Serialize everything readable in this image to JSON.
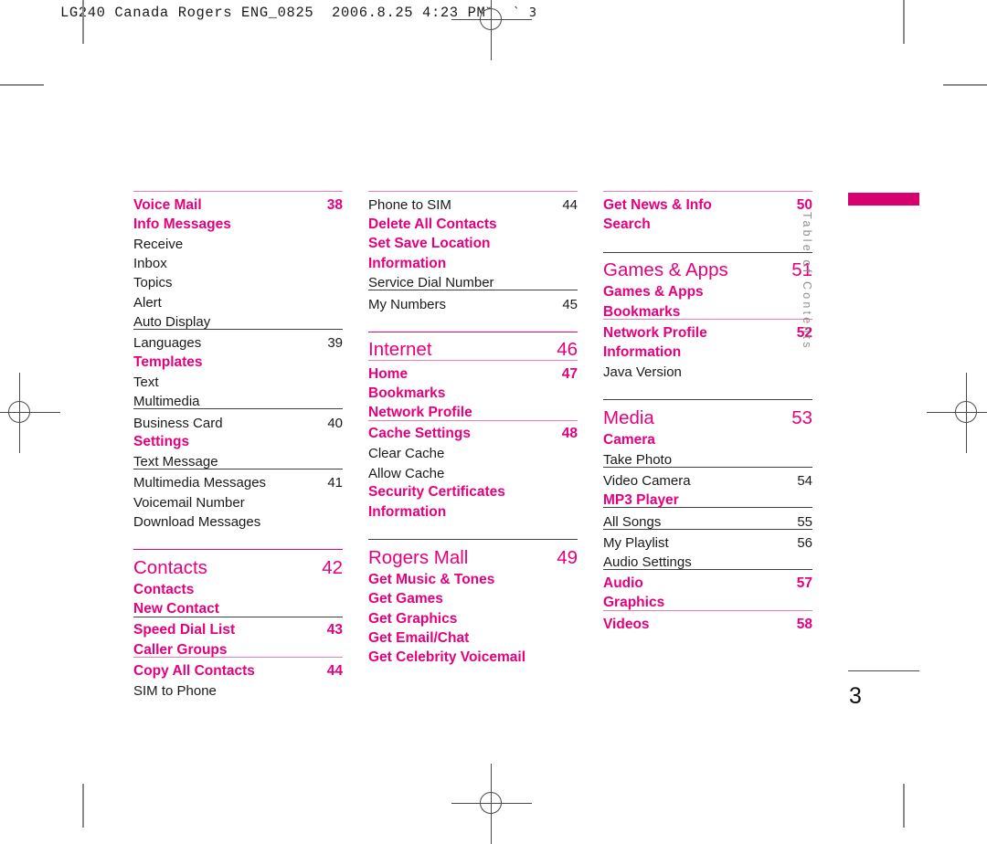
{
  "print_header": {
    "text": "LG240 Canada Rogers ENG_0825  2006.8.25 4:23 PM",
    "marks": "˘     ˋ  3"
  },
  "tab": {
    "label": "Table of Contents",
    "bar_color": "#D6006E"
  },
  "folio": {
    "page_number": "3"
  },
  "colors": {
    "accent_pink": "#E4007E",
    "light_pink_rule": "#EE7BB4",
    "dark_rule": "#404040",
    "body_text": "#1a1a1a",
    "tab_label": "#8e8e8e"
  },
  "columns": [
    {
      "id": "col-1",
      "entries": [
        {
          "title": "Voice Mail",
          "page": "38",
          "level": "sub",
          "rule": "pinklt"
        },
        {
          "title": "Info Messages",
          "page": "",
          "level": "sub",
          "rule": "none"
        },
        {
          "title": "Receive",
          "page": "",
          "level": "item",
          "rule": "none"
        },
        {
          "title": "Inbox",
          "page": "",
          "level": "item",
          "rule": "none"
        },
        {
          "title": "Topics",
          "page": "",
          "level": "item",
          "rule": "none"
        },
        {
          "title": "Alert",
          "page": "",
          "level": "item",
          "rule": "none"
        },
        {
          "title": "Auto Display",
          "page": "",
          "level": "item",
          "rule": "none"
        },
        {
          "title": "Languages",
          "page": "39",
          "level": "item",
          "rule": "dark"
        },
        {
          "title": "Templates",
          "page": "",
          "level": "sub",
          "rule": "none"
        },
        {
          "title": "Text",
          "page": "",
          "level": "item",
          "rule": "none"
        },
        {
          "title": "Multimedia",
          "page": "",
          "level": "item",
          "rule": "none"
        },
        {
          "title": "Business Card",
          "page": "40",
          "level": "item",
          "rule": "dark"
        },
        {
          "title": "Settings",
          "page": "",
          "level": "sub",
          "rule": "none"
        },
        {
          "title": "Text Message",
          "page": "",
          "level": "item",
          "rule": "none"
        },
        {
          "title": "Multimedia Messages",
          "page": "41",
          "level": "item",
          "rule": "dark"
        },
        {
          "title": "Voicemail Number",
          "page": "",
          "level": "item",
          "rule": "none"
        },
        {
          "title": "Download Messages",
          "page": "",
          "level": "item",
          "rule": "none"
        },
        {
          "title": "",
          "page": "",
          "level": "gap",
          "rule": "none"
        },
        {
          "title": "Contacts",
          "page": "42",
          "level": "section",
          "rule": "pink"
        },
        {
          "title": "Contacts",
          "page": "",
          "level": "sub",
          "rule": "none"
        },
        {
          "title": "New Contact",
          "page": "",
          "level": "sub",
          "rule": "none"
        },
        {
          "title": "Speed Dial List",
          "page": "43",
          "level": "sub",
          "rule": "dark"
        },
        {
          "title": "Caller Groups",
          "page": "",
          "level": "sub",
          "rule": "none"
        },
        {
          "title": "Copy All Contacts",
          "page": "44",
          "level": "sub",
          "rule": "pinklt"
        },
        {
          "title": "SIM to Phone",
          "page": "",
          "level": "item",
          "rule": "none"
        }
      ]
    },
    {
      "id": "col-2",
      "entries": [
        {
          "title": "Phone to SIM",
          "page": "44",
          "level": "item",
          "rule": "pinklt"
        },
        {
          "title": "Delete All Contacts",
          "page": "",
          "level": "sub",
          "rule": "none"
        },
        {
          "title": "Set Save Location",
          "page": "",
          "level": "sub",
          "rule": "none"
        },
        {
          "title": "Information",
          "page": "",
          "level": "sub",
          "rule": "none"
        },
        {
          "title": "Service Dial Number",
          "page": "",
          "level": "item",
          "rule": "none"
        },
        {
          "title": "My Numbers",
          "page": "45",
          "level": "item",
          "rule": "dark"
        },
        {
          "title": "",
          "page": "",
          "level": "gap",
          "rule": "none"
        },
        {
          "title": "Internet",
          "page": "46",
          "level": "section",
          "rule": "pink"
        },
        {
          "title": "Home",
          "page": "47",
          "level": "sub",
          "rule": "pinklt"
        },
        {
          "title": "Bookmarks",
          "page": "",
          "level": "sub",
          "rule": "none"
        },
        {
          "title": "Network Profile",
          "page": "",
          "level": "sub",
          "rule": "none"
        },
        {
          "title": "Cache Settings",
          "page": "48",
          "level": "sub",
          "rule": "pinklt"
        },
        {
          "title": "Clear Cache",
          "page": "",
          "level": "item",
          "rule": "none"
        },
        {
          "title": "Allow Cache",
          "page": "",
          "level": "item",
          "rule": "none"
        },
        {
          "title": "Security Certificates",
          "page": "",
          "level": "sub",
          "rule": "none"
        },
        {
          "title": "Information",
          "page": "",
          "level": "sub",
          "rule": "none"
        },
        {
          "title": "",
          "page": "",
          "level": "gap",
          "rule": "none"
        },
        {
          "title": "Rogers Mall",
          "page": "49",
          "level": "section",
          "rule": "dark"
        },
        {
          "title": "Get Music & Tones",
          "page": "",
          "level": "sub",
          "rule": "none"
        },
        {
          "title": "Get Games",
          "page": "",
          "level": "sub",
          "rule": "none"
        },
        {
          "title": "Get Graphics",
          "page": "",
          "level": "sub",
          "rule": "none"
        },
        {
          "title": "Get Email/Chat",
          "page": "",
          "level": "sub",
          "rule": "none"
        },
        {
          "title": "Get Celebrity Voicemail",
          "page": "",
          "level": "sub",
          "rule": "none"
        }
      ]
    },
    {
      "id": "col-3",
      "entries": [
        {
          "title": "Get News & Info",
          "page": "50",
          "level": "sub",
          "rule": "pinklt"
        },
        {
          "title": "Search",
          "page": "",
          "level": "sub",
          "rule": "none"
        },
        {
          "title": "",
          "page": "",
          "level": "gap",
          "rule": "none"
        },
        {
          "title": "Games & Apps",
          "page": "51",
          "level": "section",
          "rule": "dark"
        },
        {
          "title": "Games & Apps",
          "page": "",
          "level": "sub",
          "rule": "none"
        },
        {
          "title": "Bookmarks",
          "page": "",
          "level": "sub",
          "rule": "none"
        },
        {
          "title": "Network Profile",
          "page": "52",
          "level": "sub",
          "rule": "pinklt"
        },
        {
          "title": "Information",
          "page": "",
          "level": "sub",
          "rule": "none"
        },
        {
          "title": "Java Version",
          "page": "",
          "level": "item",
          "rule": "none"
        },
        {
          "title": "",
          "page": "",
          "level": "gap",
          "rule": "none"
        },
        {
          "title": "Media",
          "page": "53",
          "level": "section",
          "rule": "dark"
        },
        {
          "title": "Camera",
          "page": "",
          "level": "sub",
          "rule": "none"
        },
        {
          "title": "Take Photo",
          "page": "",
          "level": "item",
          "rule": "none"
        },
        {
          "title": "Video Camera",
          "page": "54",
          "level": "item",
          "rule": "dark"
        },
        {
          "title": "MP3 Player",
          "page": "",
          "level": "sub",
          "rule": "none"
        },
        {
          "title": "All Songs",
          "page": "55",
          "level": "item",
          "rule": "dark"
        },
        {
          "title": "My Playlist",
          "page": "56",
          "level": "item",
          "rule": "dark"
        },
        {
          "title": "Audio Settings",
          "page": "",
          "level": "item",
          "rule": "none"
        },
        {
          "title": "Audio",
          "page": "57",
          "level": "sub",
          "rule": "dark"
        },
        {
          "title": "Graphics",
          "page": "",
          "level": "sub",
          "rule": "none"
        },
        {
          "title": "Videos",
          "page": "58",
          "level": "sub",
          "rule": "pinklt"
        }
      ]
    }
  ]
}
